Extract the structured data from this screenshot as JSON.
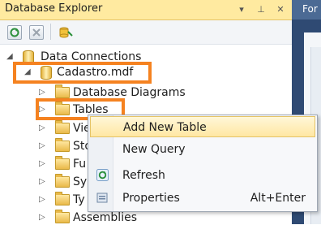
{
  "panel": {
    "title": "Database Explorer",
    "right_tab": "For"
  },
  "tree": {
    "root": "Data Connections",
    "db": "Cadastro.mdf",
    "children": [
      "Database Diagrams",
      "Tables",
      "Vie",
      "Sto",
      "Fu",
      "Sy",
      "Ty",
      "Assemblies"
    ]
  },
  "context_menu": {
    "items": [
      {
        "label": "Add New Table",
        "shortcut": ""
      },
      {
        "label": "New Query",
        "shortcut": ""
      },
      {
        "label": "Refresh",
        "shortcut": ""
      },
      {
        "label": "Properties",
        "shortcut": "Alt+Enter"
      }
    ]
  },
  "icons": {
    "pin": "pin-icon",
    "close": "close-icon",
    "dropdown": "dropdown-icon"
  },
  "colors": {
    "highlight_border": "#f58220",
    "title_bar": "#ffeaa0",
    "menu_hover": "#ffe7a3"
  }
}
